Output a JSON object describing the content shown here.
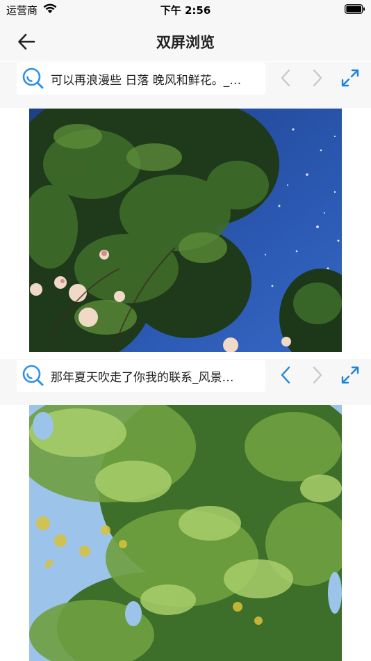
{
  "status_bar": {
    "carrier": "运营商",
    "time": "下午 2:56"
  },
  "nav": {
    "title": "双屏浏览"
  },
  "panes": [
    {
      "query": "可以再浪漫些 日落 晚风和鲜花。_…",
      "prev_enabled": false,
      "next_enabled": false,
      "image_icon": "tree-night-sky-image"
    },
    {
      "query": "那年夏天吹走了你我的联系_风景…",
      "prev_enabled": true,
      "next_enabled": false,
      "image_icon": "green-leaves-image"
    }
  ],
  "colors": {
    "accent": "#1a82e0",
    "disabled": "#c8c8c8",
    "bar_bg": "#f7f7f7"
  }
}
